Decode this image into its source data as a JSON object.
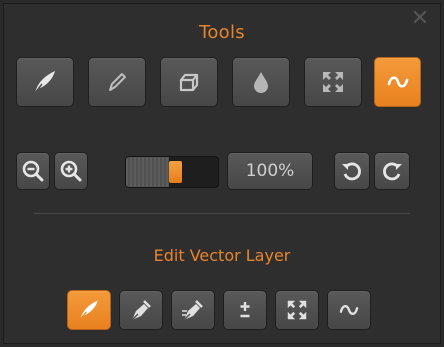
{
  "panel": {
    "title": "Tools",
    "close_icon": "close-icon"
  },
  "tools": [
    {
      "name": "brush-tool-button",
      "icon": "feather-icon",
      "active": false
    },
    {
      "name": "pencil-tool-button",
      "icon": "pencil-icon",
      "active": false
    },
    {
      "name": "eraser-tool-button",
      "icon": "eraser-icon",
      "active": false
    },
    {
      "name": "fill-tool-button",
      "icon": "drop-icon",
      "active": false
    },
    {
      "name": "transform-tool-button",
      "icon": "expand-arrows-icon",
      "active": false
    },
    {
      "name": "curve-tool-button",
      "icon": "wave-icon",
      "active": true
    }
  ],
  "view": {
    "zoom_out_icon": "zoom-out-icon",
    "zoom_in_icon": "zoom-in-icon",
    "zoom_level": "100%",
    "zoom_slider_fraction": 0.55,
    "rotate_left_icon": "rotate-ccw-icon",
    "rotate_right_icon": "rotate-cw-icon"
  },
  "vector": {
    "title": "Edit Vector Layer",
    "tools": [
      {
        "name": "vector-brush-button",
        "icon": "feather-icon",
        "active": true
      },
      {
        "name": "vector-pen-add-button",
        "icon": "pen-icon",
        "active": false
      },
      {
        "name": "vector-pen-remove-button",
        "icon": "pen-move-icon",
        "active": false
      },
      {
        "name": "vector-plus-minus-button",
        "icon": "plus-minus-icon",
        "active": false
      },
      {
        "name": "vector-transform-button",
        "icon": "expand-arrows-icon",
        "active": false
      },
      {
        "name": "vector-curve-button",
        "icon": "wave-icon",
        "active": false
      }
    ]
  },
  "colors": {
    "accent": "#E8852C",
    "button": "#505050",
    "panel": "#2E2E2E"
  }
}
